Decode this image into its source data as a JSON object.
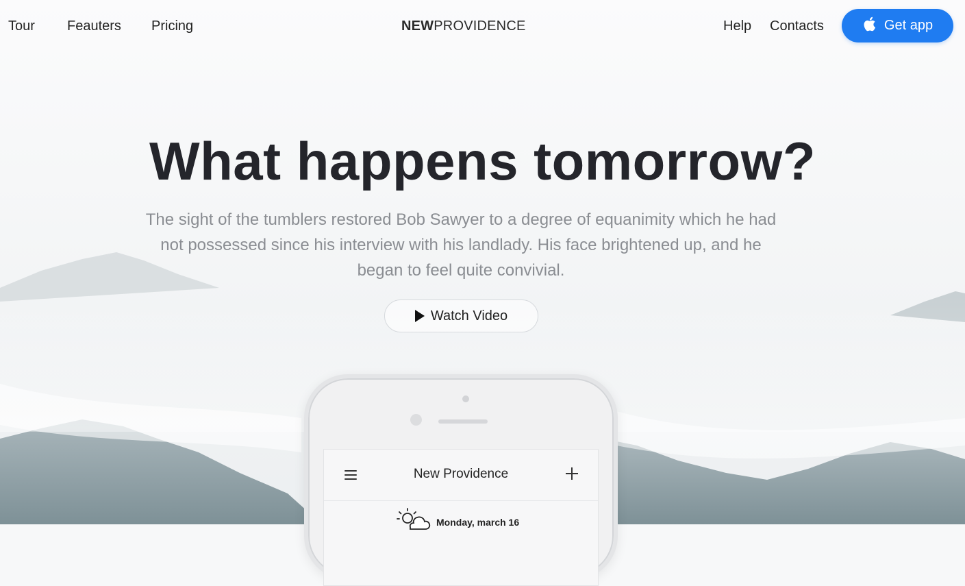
{
  "nav": {
    "left_links": [
      "Tour",
      "Feauters",
      "Pricing"
    ],
    "logo_bold": "NEW",
    "logo_regular": "PROVIDENCE",
    "right_links": [
      "Help",
      "Contacts"
    ],
    "cta_label": "Get app",
    "cta_icon": "apple-icon"
  },
  "hero": {
    "title": "What happens tomorrow?",
    "subtitle": "The sight of the tumblers restored Bob Sawyer to a degree of equanimity which he had not possessed since his interview with his landlady. His face brightened up, and he began to feel quite convivial.",
    "video_button": "Watch Video",
    "video_icon": "play-icon"
  },
  "phone": {
    "app_title": "New Providence",
    "menu_icon": "hamburger-menu-icon",
    "add_icon": "plus-icon",
    "weather_icon": "sun-cloud-icon",
    "date_text": "Monday, march 16"
  },
  "colors": {
    "accent": "#1f7cf1",
    "title": "#24252b",
    "subtitle": "#8a8d92"
  }
}
